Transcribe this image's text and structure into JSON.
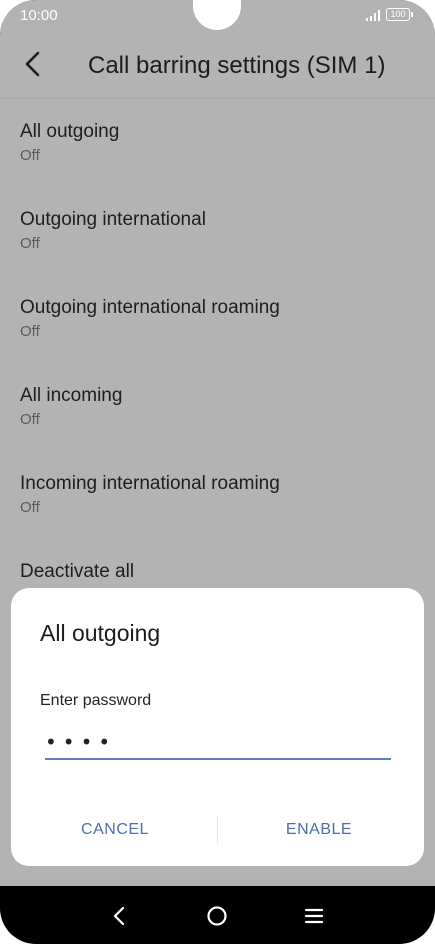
{
  "status_bar": {
    "time": "10:00",
    "battery": "100"
  },
  "header": {
    "title": "Call barring settings (SIM 1)"
  },
  "settings": {
    "items": [
      {
        "title": "All outgoing",
        "status": "Off"
      },
      {
        "title": "Outgoing international",
        "status": "Off"
      },
      {
        "title": "Outgoing international roaming",
        "status": "Off"
      },
      {
        "title": "All incoming",
        "status": "Off"
      },
      {
        "title": "Incoming international roaming",
        "status": "Off"
      },
      {
        "title": "Deactivate all"
      }
    ]
  },
  "dialog": {
    "title": "All outgoing",
    "password_label": "Enter password",
    "password_value": "••••",
    "cancel_label": "CANCEL",
    "enable_label": "ENABLE"
  },
  "colors": {
    "accent": "#4b6fb0",
    "scrim": "#b3b3b3"
  }
}
